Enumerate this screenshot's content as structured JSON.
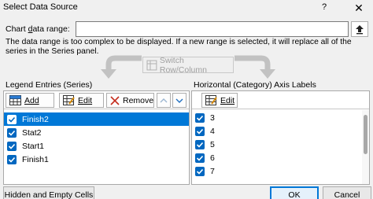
{
  "dialog": {
    "title": "Select Data Source",
    "help": "?",
    "close": "✕"
  },
  "range": {
    "label_pre": "Chart ",
    "label_u": "d",
    "label_post": "ata range:",
    "value": "",
    "info": "The data range is too complex to be displayed. If a new range is selected, it will replace all of the series in the Series panel."
  },
  "switch": {
    "label": "Switch Row/Column"
  },
  "legend": {
    "heading": "Legend Entries (Series)",
    "add": "Add",
    "edit": "Edit",
    "remove": "Remove",
    "series": [
      {
        "name": "Finish2",
        "checked": true,
        "selected": true
      },
      {
        "name": "Stat2",
        "checked": true,
        "selected": false
      },
      {
        "name": "Start1",
        "checked": true,
        "selected": false
      },
      {
        "name": "Finish1",
        "checked": true,
        "selected": false
      }
    ]
  },
  "axis": {
    "heading": "Horizontal (Category) Axis Labels",
    "edit": "Edit",
    "labels": [
      "3",
      "4",
      "5",
      "6",
      "7"
    ]
  },
  "buttons": {
    "hidden": "Hidden and Empty Cells",
    "ok": "OK",
    "cancel": "Cancel"
  },
  "colors": {
    "accent": "#0078d7",
    "checkbox": "#0067c0",
    "remove_icon": "#c42b1c"
  }
}
